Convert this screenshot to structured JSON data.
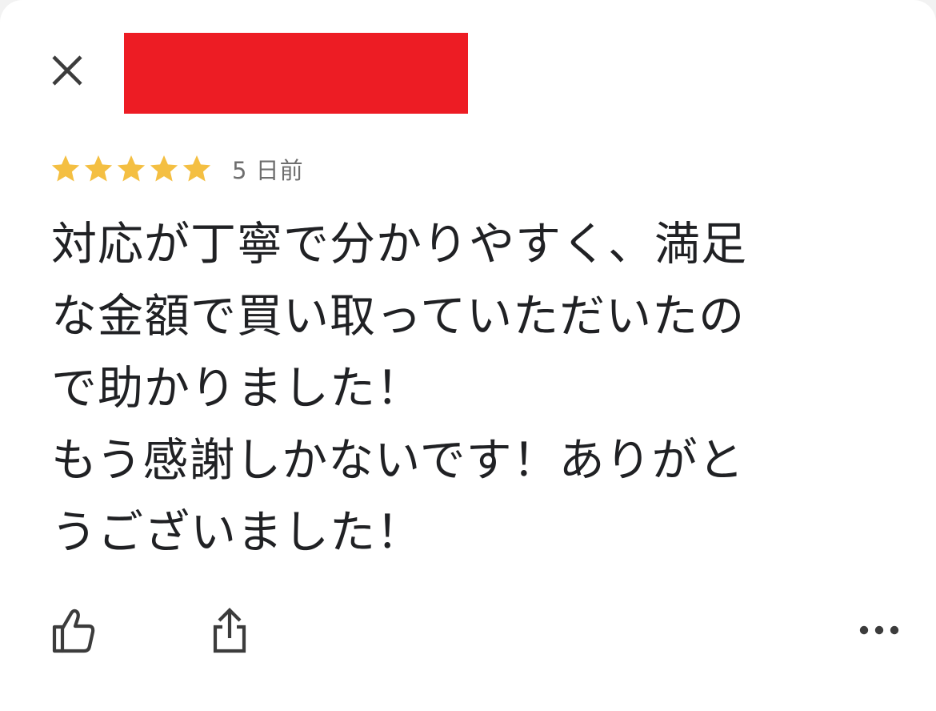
{
  "header": {
    "close_icon": "close-icon",
    "redaction_color": "#ed1c24"
  },
  "review": {
    "rating": 5,
    "rating_max": 5,
    "star_color": "#f4bf42",
    "age": "5 日前",
    "lines": [
      "対応が丁寧で分かりやすく、満足",
      "な金額で買い取っていただいたの",
      "で助かりました！",
      "もう感謝しかないです！ありがと",
      "うございました！"
    ]
  },
  "actions": {
    "like_icon": "thumbs-up-icon",
    "share_icon": "share-icon",
    "more_icon": "more-horizontal-icon"
  }
}
